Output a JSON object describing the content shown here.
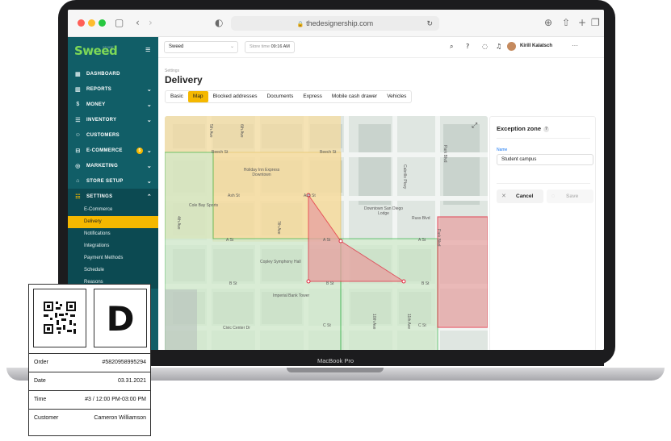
{
  "browser": {
    "url": "thedesignership.com"
  },
  "device_label": "MacBook Pro",
  "sidebar": {
    "logo": "Sweed",
    "logo_sub": "STORE",
    "items": [
      {
        "label": "DASHBOARD",
        "icon": "grid-icon"
      },
      {
        "label": "REPORTS",
        "icon": "bar-chart-icon"
      },
      {
        "label": "MONEY",
        "icon": "dollar-icon"
      },
      {
        "label": "INVENTORY",
        "icon": "list-icon"
      },
      {
        "label": "CUSTOMERS",
        "icon": "user-icon"
      },
      {
        "label": "E-COMMERCE",
        "icon": "cart-icon",
        "badge": "5"
      },
      {
        "label": "MARKETING",
        "icon": "target-icon"
      },
      {
        "label": "STORE SETUP",
        "icon": "store-icon"
      },
      {
        "label": "SETTINGS",
        "icon": "sliders-icon"
      }
    ],
    "settings_sub": [
      "E-Commerce",
      "Delivery",
      "Notifications",
      "Integrations",
      "Payment Methods",
      "Schedule",
      "Reasons"
    ]
  },
  "topbar": {
    "store": "Sweed",
    "store_time_label": "Store time",
    "store_time": "09:16 AM",
    "user": "Kirill Kalatsch"
  },
  "page": {
    "breadcrumb": "Settings",
    "title": "Delivery",
    "tabs": [
      "Basic",
      "Map",
      "Blocked addresses",
      "Documents",
      "Express",
      "Mobile cash drawer",
      "Vehicles"
    ],
    "active_tab": "Map"
  },
  "map": {
    "labels": [
      "Beech St",
      "Beech St",
      "Holiday Inn Express Downtown",
      "Ash St",
      "Ash St",
      "Cole Bay Sports",
      "A St",
      "A St",
      "A St",
      "Downtown San Diego Lodge",
      "Russ Blvd",
      "Copley Symphony Hall",
      "B St",
      "B St",
      "B St",
      "Imperial Bank Tower",
      "Civic Center Dr",
      "C St",
      "C St",
      "Park Blvd",
      "Cabrillo Pkwy",
      "4th Ave",
      "5th Ave",
      "6th Ave",
      "7th Ave",
      "10th Ave",
      "11th Ave",
      "Park Blvd"
    ]
  },
  "panel": {
    "title": "Exception zone",
    "name_label": "Name",
    "name_value": "Student campus",
    "cancel": "Cancel",
    "save": "Save"
  },
  "receipt": {
    "big_letter": "D",
    "rows": [
      {
        "key": "Order",
        "value": "#5820958995294"
      },
      {
        "key": "Date",
        "value": "03.31.2021"
      },
      {
        "key": "Time",
        "value": "#3 / 12:00 PM-03:00 PM"
      },
      {
        "key": "Customer",
        "value": "Cameron Williamson"
      }
    ]
  },
  "colors": {
    "sidebar": "#115e67",
    "accent": "#f5b800",
    "zone_yellow": "#f6dca0",
    "zone_green": "#cfe9c9",
    "zone_red": "#e8a0a0"
  }
}
